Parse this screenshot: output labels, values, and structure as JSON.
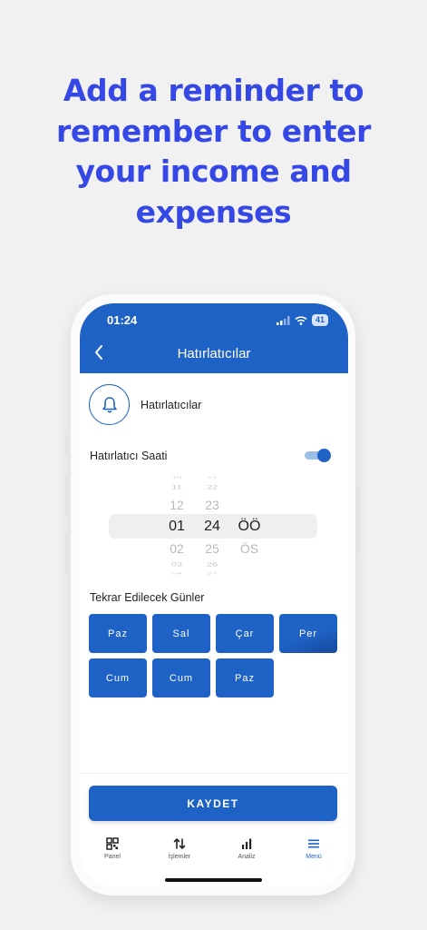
{
  "headline": [
    "Add a reminder to",
    "remember to enter",
    "your income and",
    "expenses"
  ],
  "status_bar": {
    "time": "01:24",
    "battery": "41"
  },
  "header": {
    "title": "Hatırlatıcılar"
  },
  "reminder_section": {
    "label": "Hatırlatıcılar"
  },
  "reminder_time": {
    "label": "Hatırlatıcı Saati",
    "enabled": true
  },
  "time_picker": {
    "hours": [
      "11",
      "12",
      "01",
      "02",
      "03"
    ],
    "minutes": [
      "22",
      "23",
      "24",
      "25",
      "26"
    ],
    "periods": [
      "ÖÖ",
      "ÖS"
    ],
    "selected": {
      "hour": "01",
      "minute": "24",
      "period": "ÖÖ"
    }
  },
  "repeat_days": {
    "label": "Tekrar Edilecek Günler",
    "days": [
      "Paz",
      "Sal",
      "Çar",
      "Per",
      "Cum",
      "Cum",
      "Paz"
    ]
  },
  "save_button": "KAYDET",
  "bottom_nav": {
    "items": [
      {
        "label": "Panel",
        "icon": "grid-icon"
      },
      {
        "label": "İşlemler",
        "icon": "transfer-arrows-icon"
      },
      {
        "label": "Analiz",
        "icon": "bar-chart-icon"
      },
      {
        "label": "Menü",
        "icon": "menu-icon"
      }
    ],
    "active": "Menü"
  },
  "colors": {
    "accent": "#1f62c6",
    "headline": "#3547e4"
  }
}
